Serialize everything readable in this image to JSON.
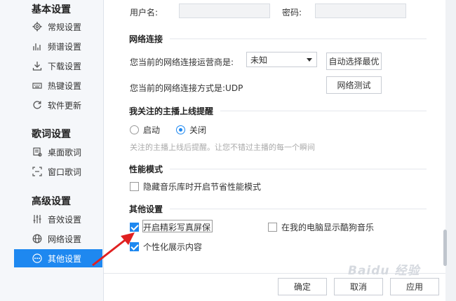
{
  "sidebar": {
    "sections": [
      {
        "title": "基本设置",
        "items": [
          "常规设置",
          "频谱设置",
          "下载设置",
          "热键设置",
          "软件更新"
        ]
      },
      {
        "title": "歌词设置",
        "items": [
          "桌面歌词",
          "窗口歌词"
        ]
      },
      {
        "title": "高级设置",
        "items": [
          "音效设置",
          "网络设置",
          "其他设置"
        ]
      }
    ]
  },
  "account": {
    "username_label": "用户名:",
    "password_label": "密码:"
  },
  "network": {
    "title": "网络连接",
    "isp_label": "您当前的网络连接运营商是:",
    "isp_value": "未知",
    "auto_select_button": "自动选择最优",
    "mode_label": "您当前的网络连接方式是:UDP",
    "test_button": "网络测试"
  },
  "anchor_notify": {
    "title": "我关注的主播上线提醒",
    "on_label": "启动",
    "off_label": "关闭",
    "hint": "关注的主播上线后提醒。让您不错过主播的每一个瞬间"
  },
  "performance": {
    "title": "性能模式",
    "hide_label": "隐藏音乐库时开启节省性能模式"
  },
  "other": {
    "title": "其他设置",
    "screensaver_label": "开启精彩写真屏保",
    "pc_show_label": "在我的电脑显示酷狗音乐",
    "personal_label": "个性化展示内容"
  },
  "footer": {
    "ok": "确定",
    "cancel": "取消",
    "apply": "应用"
  },
  "watermark": "Baidu 经验",
  "colors": {
    "accent": "#1e88f0",
    "arrow": "#e02020"
  }
}
